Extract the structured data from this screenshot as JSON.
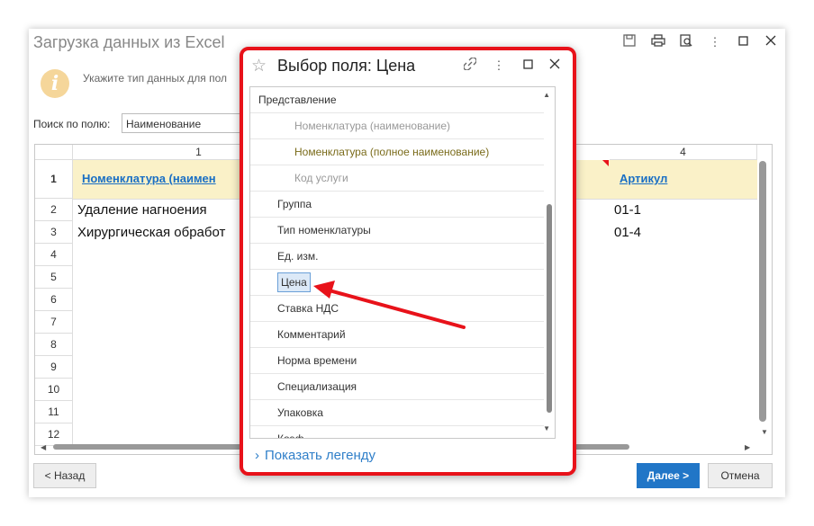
{
  "window": {
    "title": "Загрузка данных из Excel",
    "hint": "Укажите тип данных для пол",
    "search_label": "Поиск по полю:",
    "search_value": "Наименование",
    "back_label": "< Назад",
    "next_label": "Далее >",
    "cancel_label": "Отмена"
  },
  "grid": {
    "col_headers": [
      "1",
      "4"
    ],
    "header_row_number": "1",
    "header_cells": [
      "Номенклатура (наимен",
      "Артикул"
    ],
    "rows": [
      {
        "num": "2",
        "name": "Удаление нагноения",
        "code": "01-1"
      },
      {
        "num": "3",
        "name": "Хирургическая обработ",
        "code": "01-4"
      },
      {
        "num": "4",
        "name": "",
        "code": ""
      },
      {
        "num": "5",
        "name": "",
        "code": ""
      },
      {
        "num": "6",
        "name": "",
        "code": ""
      },
      {
        "num": "7",
        "name": "",
        "code": ""
      },
      {
        "num": "8",
        "name": "",
        "code": ""
      },
      {
        "num": "9",
        "name": "",
        "code": ""
      },
      {
        "num": "10",
        "name": "",
        "code": ""
      },
      {
        "num": "11",
        "name": "",
        "code": ""
      },
      {
        "num": "12",
        "name": "",
        "code": ""
      }
    ]
  },
  "dialog": {
    "title": "Выбор поля: Цена",
    "items": [
      {
        "label": "Представление",
        "kind": "group"
      },
      {
        "label": "Номенклатура (наименование)",
        "kind": "sub"
      },
      {
        "label": "Номенклатура (полное наименование)",
        "kind": "sub-full"
      },
      {
        "label": "Код услуги",
        "kind": "sub"
      },
      {
        "label": "Группа",
        "kind": "item"
      },
      {
        "label": "Тип номенклатуры",
        "kind": "item"
      },
      {
        "label": "Ед. изм.",
        "kind": "item"
      },
      {
        "label": "Цена",
        "kind": "selected"
      },
      {
        "label": "Ставка НДС",
        "kind": "item"
      },
      {
        "label": "Комментарий",
        "kind": "item"
      },
      {
        "label": "Норма времени",
        "kind": "item"
      },
      {
        "label": "Специализация",
        "kind": "item"
      },
      {
        "label": "Упаковка",
        "kind": "item"
      },
      {
        "label": "Коэф",
        "kind": "item"
      }
    ],
    "legend_label": "Показать легенду"
  },
  "colors": {
    "accent": "#2176c7",
    "highlight_border": "#e8121a",
    "header_row_bg": "#faf1c8",
    "link": "#1a6fc4"
  }
}
